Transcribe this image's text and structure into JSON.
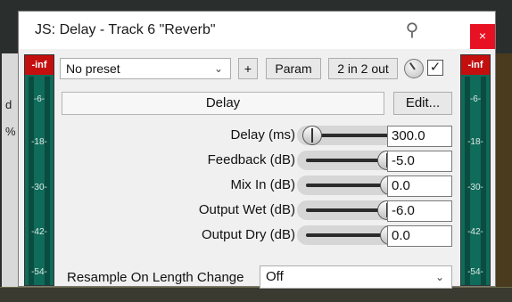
{
  "window": {
    "title": "JS: Delay - Track 6 \"Reverb\"",
    "close_label": "×"
  },
  "toolbar": {
    "preset": "No preset",
    "add_label": "+",
    "param_label": "Param",
    "io_label": "2 in 2 out",
    "enabled_check": "✓"
  },
  "meters": {
    "top_label": "-inf",
    "ticks": [
      "-6-",
      "-18-",
      "-30-",
      "-42-",
      "-54-"
    ]
  },
  "section": {
    "name": "Delay",
    "edit_label": "Edit..."
  },
  "params": [
    {
      "label": "Delay (ms)",
      "value": "300.0",
      "position": 0.0
    },
    {
      "label": "Feedback (dB)",
      "value": "-5.0",
      "position": 0.89
    },
    {
      "label": "Mix In (dB)",
      "value": "0.0",
      "position": 0.93
    },
    {
      "label": "Output Wet (dB)",
      "value": "-6.0",
      "position": 0.89
    },
    {
      "label": "Output Dry (dB)",
      "value": "0.0",
      "position": 0.93
    }
  ],
  "resample": {
    "label": "Resample On Length Change",
    "value": "Off"
  },
  "background": {
    "left_glyph_1": "d",
    "left_glyph_2": "%"
  },
  "colors": {
    "meter_bg": "#0f6b5a",
    "clip_red": "#c40f0f",
    "close_red": "#e81123"
  }
}
